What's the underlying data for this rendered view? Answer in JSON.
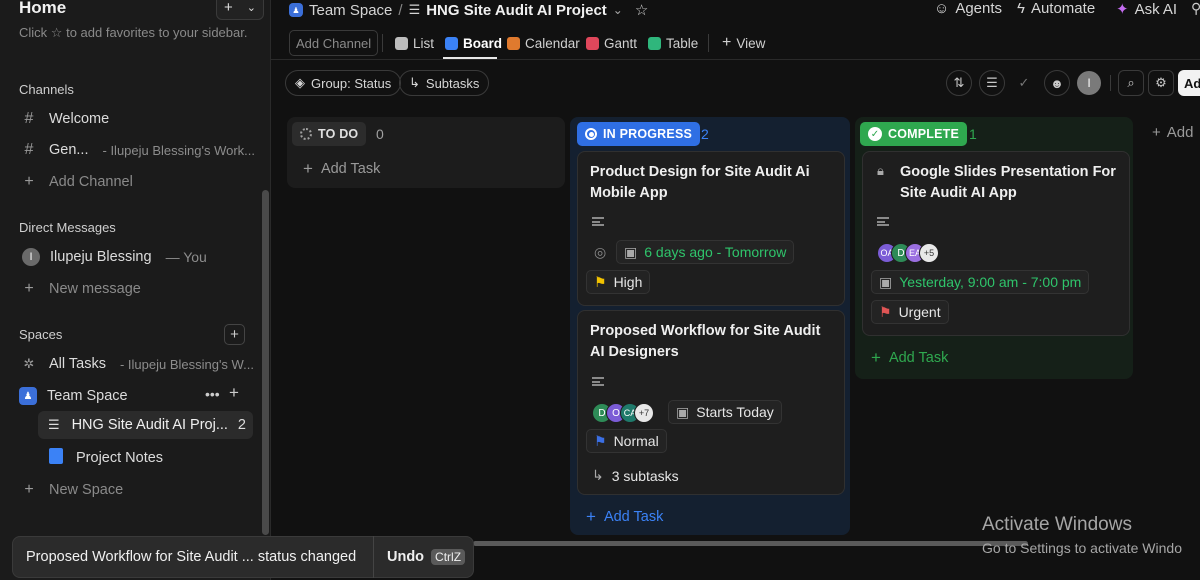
{
  "sidebar": {
    "home_title": "Home",
    "favorites_hint_pre": "Click",
    "favorites_hint_post": "to add favorites to your sidebar.",
    "channels_label": "Channels",
    "channels": [
      {
        "label": "Welcome",
        "sub": ""
      },
      {
        "label": "Gen...",
        "sub": "- Ilupeju Blessing's Work..."
      }
    ],
    "add_channel": "Add Channel",
    "dm_label": "Direct Messages",
    "dm_user_initial": "I",
    "dm_user": "Ilupeju Blessing",
    "dm_you": "— You",
    "new_message": "New message",
    "spaces_label": "Spaces",
    "all_tasks": "All Tasks",
    "all_tasks_sub": "- Ilupeju Blessing's W...",
    "team_space": "Team Space",
    "project": "HNG Site Audit AI Proj...",
    "project_count": "2",
    "project_notes": "Project Notes",
    "new_space": "New Space"
  },
  "breadcrumb": {
    "space": "Team Space",
    "sep": "/",
    "project": "HNG Site Audit AI Project"
  },
  "top_actions": {
    "agents": "Agents",
    "automate": "Automate",
    "ask_ai": "Ask AI"
  },
  "views": {
    "add_channel": "Add Channel",
    "tabs": [
      {
        "label": "List",
        "color": "#bdbdbd"
      },
      {
        "label": "Board",
        "color": "#3b82f6"
      },
      {
        "label": "Calendar",
        "color": "#e07a2e"
      },
      {
        "label": "Gantt",
        "color": "#e0475b"
      },
      {
        "label": "Table",
        "color": "#2fb67c"
      }
    ],
    "add_view": "View"
  },
  "filters": {
    "group": "Group: Status",
    "subtasks": "Subtasks",
    "user_initial": "I",
    "add_label": "Ad"
  },
  "columns": {
    "todo": {
      "label": "TO DO",
      "count": "0",
      "add_task": "Add Task",
      "color": "#a0a0a0"
    },
    "in_progress": {
      "label": "IN PROGRESS",
      "count": "2",
      "add_task": "Add Task",
      "color": "#2f6fe4"
    },
    "complete": {
      "label": "COMPLETE",
      "count": "1",
      "add_task": "Add Task",
      "color": "#2fa84f"
    },
    "add_group": "Add"
  },
  "cards": {
    "c1": {
      "title": "Product Design for Site Audit Ai Mobile App",
      "dates": "6 days ago - Tomorrow",
      "priority": "High",
      "priority_color": "#f2c200"
    },
    "c2": {
      "title": "Proposed Workflow for Site Audit AI Designers",
      "assignees": [
        {
          "initials": "D",
          "color": "#2e8b57"
        },
        {
          "initials": "O",
          "color": "#7b5cd6"
        },
        {
          "initials": "CA",
          "color": "#1f7a6b"
        }
      ],
      "more": "+7",
      "dates": "Starts Today",
      "priority": "Normal",
      "priority_color": "#3b6fe4",
      "subtasks": "3 subtasks"
    },
    "c3": {
      "title": "Google Slides Presentation For Site Audit AI App",
      "assignees": [
        {
          "initials": "OA",
          "color": "#7b5cd6"
        },
        {
          "initials": "D",
          "color": "#2e8b57"
        },
        {
          "initials": "EA",
          "color": "#9b6fe0"
        }
      ],
      "more": "+5",
      "dates": "Yesterday, 9:00 am - 7:00 pm",
      "priority": "Urgent",
      "priority_color": "#e05555"
    }
  },
  "toast": {
    "message": "Proposed Workflow for Site Audit ... status changed",
    "undo": "Undo",
    "shortcut": "CtrlZ"
  },
  "watermark": {
    "line1": "Activate Windows",
    "line2": "Go to Settings to activate Windo"
  }
}
